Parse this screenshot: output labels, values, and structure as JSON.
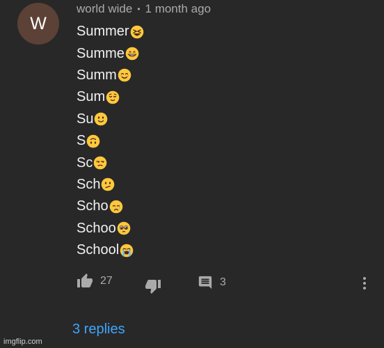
{
  "author": {
    "avatar_letter": "W",
    "name": "world wide",
    "separator": "•",
    "time": "1 month ago"
  },
  "comment_lines": [
    {
      "text": "Summer",
      "emoji": "laughing-squint-emoji"
    },
    {
      "text": "Summe",
      "emoji": "grinning-teeth-emoji"
    },
    {
      "text": "Summ",
      "emoji": "smiling-eyes-emoji"
    },
    {
      "text": "Sum",
      "emoji": "relieved-emoji"
    },
    {
      "text": "Su",
      "emoji": "slight-smile-emoji"
    },
    {
      "text": "S",
      "emoji": "upside-down-emoji"
    },
    {
      "text": "Sc",
      "emoji": "unamused-emoji"
    },
    {
      "text": "Sch",
      "emoji": "confused-emoji"
    },
    {
      "text": "Scho",
      "emoji": "crying-emoji"
    },
    {
      "text": "Schoo",
      "emoji": "pleading-emoji"
    },
    {
      "text": "School",
      "emoji": "loudly-crying-emoji"
    }
  ],
  "actions": {
    "likes": "27",
    "replies_count": "3"
  },
  "replies_link": "3 replies",
  "watermark": "imgflip.com",
  "colors": {
    "background": "#282828",
    "text": "#f1f1f1",
    "secondary_text": "#aaaaaa",
    "link": "#3ea6ff",
    "avatar": "#5c4136",
    "emoji_face": "#ffc83d"
  }
}
